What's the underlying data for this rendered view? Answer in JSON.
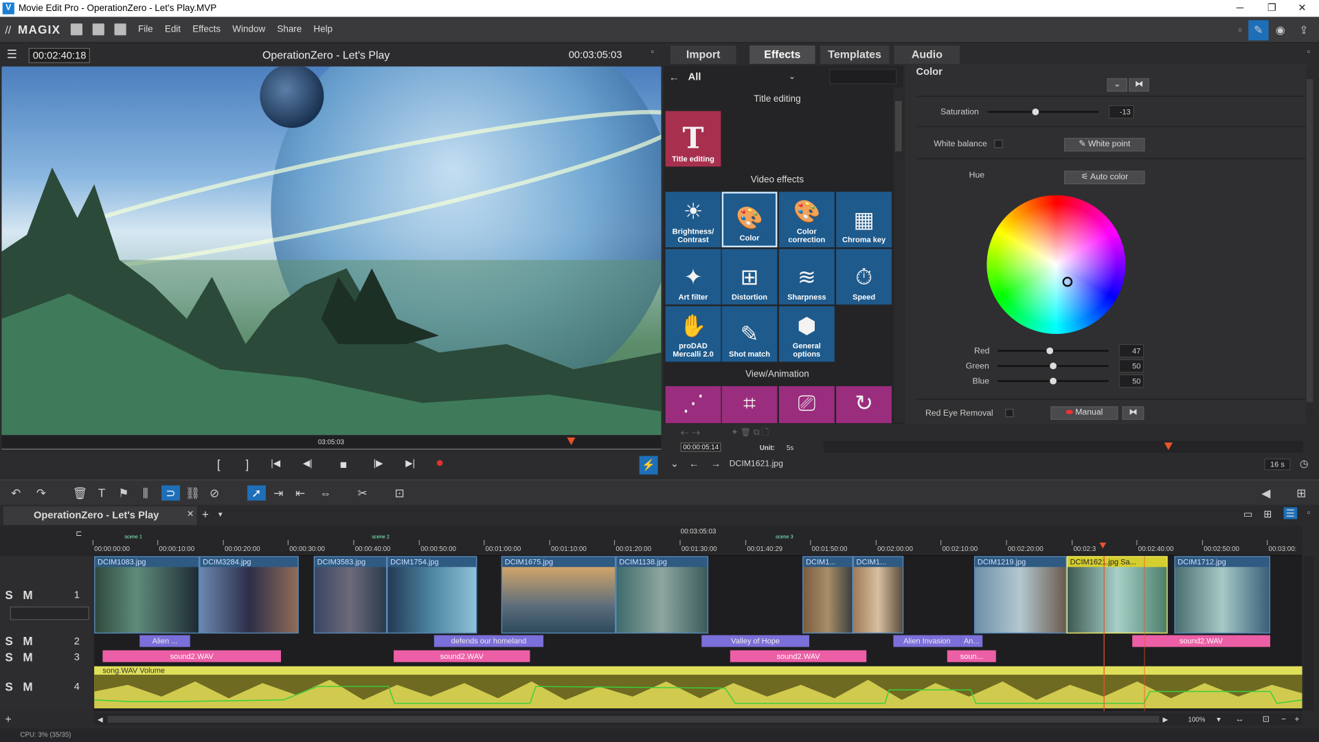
{
  "window": {
    "title": "Movie Edit Pro - OperationZero - Let's Play.MVP",
    "logo": "V",
    "min": "─",
    "max": "❐",
    "close": "✕"
  },
  "menu": {
    "brand": "MAGIX",
    "items": [
      "File",
      "Edit",
      "Effects",
      "Window",
      "Share",
      "Help"
    ]
  },
  "preview": {
    "timecode_left": "00:02:40:18",
    "title": "OperationZero - Let's Play",
    "timecode_right": "00:03:05:03",
    "scrub_label": "03:05:03"
  },
  "transport": {
    "mark_in": "[",
    "mark_out": "]",
    "prev_marker": "|◀",
    "prev": "◀|",
    "stop": "■",
    "next": "|▶",
    "next_marker": "▶|",
    "record": "●"
  },
  "tabs": [
    "Import",
    "Effects",
    "Templates",
    "Audio"
  ],
  "effects": {
    "filter": "All",
    "section_title": "Title editing",
    "title_tile": {
      "glyph": "T",
      "label": "Title editing"
    },
    "section_video": "Video effects",
    "tiles": [
      {
        "glyph": "☀",
        "l1": "Brightness/",
        "l2": "Contrast"
      },
      {
        "glyph": "🎨",
        "l1": "Color",
        "l2": ""
      },
      {
        "glyph": "🎨",
        "l1": "Color",
        "l2": "correction"
      },
      {
        "glyph": "▦",
        "l1": "Chroma key",
        "l2": ""
      },
      {
        "glyph": "✦",
        "l1": "Art filter",
        "l2": ""
      },
      {
        "glyph": "⊞",
        "l1": "Distortion",
        "l2": ""
      },
      {
        "glyph": "≋",
        "l1": "Sharpness",
        "l2": ""
      },
      {
        "glyph": "⏱",
        "l1": "Speed",
        "l2": ""
      },
      {
        "glyph": "✋",
        "l1": "proDAD",
        "l2": "Mercalli 2.0"
      },
      {
        "glyph": "✎",
        "l1": "Shot match",
        "l2": ""
      },
      {
        "glyph": "⬢",
        "l1": "General",
        "l2": "options"
      }
    ],
    "section_view": "View/Animation"
  },
  "color_panel": {
    "title": "Color",
    "saturation_label": "Saturation",
    "saturation_value": "-13",
    "white_balance_label": "White balance",
    "white_point_button": "White point",
    "hue_label": "Hue",
    "auto_color_button": "Auto color",
    "red_label": "Red",
    "red_value": "47",
    "green_label": "Green",
    "green_value": "50",
    "blue_label": "Blue",
    "blue_value": "50",
    "red_eye_label": "Red Eye Removal",
    "manual_button": "Manual"
  },
  "effect_footer": {
    "timecode": "00:00:05:14",
    "unit_label": "Unit:",
    "unit_value": "5s",
    "file": "DCIM1621.jpg",
    "zoom": "16 s"
  },
  "timeline": {
    "project_tab": "OperationZero - Let's Play",
    "center_time": "00:03:05:03",
    "scene_labels": [
      "scene 1",
      "scene 2",
      "scene 3"
    ],
    "ticks": [
      "00:00:00:00",
      "00:00:10:00",
      "00:00:20:00",
      "00:00:30:00",
      "00:00:40:00",
      "00:00:50:00",
      "00:01:00:00",
      "00:01:10:00",
      "00:01:20:00",
      "00:01:30:00",
      "00:01:40:29",
      "00:01:50:00",
      "00:02:00:00",
      "00:02:10:00",
      "00:02:20:00",
      "00:02:3",
      "00:02:40:00",
      "00:02:50:00",
      "00:03:00:"
    ],
    "track_ctrl": "S M",
    "track_nums": [
      "1",
      "2",
      "3",
      "4"
    ],
    "video_clips": [
      "DCIM1083.jpg",
      "DCIM3284.jpg",
      "DCIM3583.jpg",
      "DCIM1754.jpg",
      "DCIM1675.jpg",
      "DCIM1138.jpg",
      "DCIM1...",
      "DCIM1...",
      "DCIM1219.jpg",
      "DCIM1621.jpg",
      "Sa...",
      "DCIM1712.jpg"
    ],
    "title_clips": [
      "Alien ...",
      "defends our homeland",
      "Valley of Hope",
      "Alien Invasion",
      "An...",
      "sound2.WAV"
    ],
    "audio_clips": [
      "sound2.WAV",
      "sound2.WAV",
      "sound2.WAV",
      "soun..."
    ],
    "song_label": "song.WAV  Volume",
    "zoom": "100%",
    "status": "CPU: 3% (35/35)"
  }
}
